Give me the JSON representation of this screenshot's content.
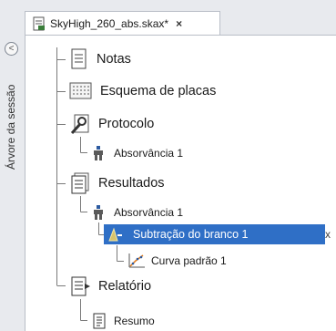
{
  "tab": {
    "title": "SkyHigh_260_abs.skax*",
    "close": "×"
  },
  "sidebar": {
    "label": "Árvore da sessão",
    "collapse": "<"
  },
  "tree": {
    "notas": "Notas",
    "esquema": "Esquema de placas",
    "protocolo": "Protocolo",
    "protocolo_abs": "Absorvância 1",
    "resultados": "Resultados",
    "resultados_abs": "Absorvância 1",
    "subtracao": "Subtração do branco 1",
    "subtracao_trailing": "x",
    "curva": "Curva padrão 1",
    "relatorio": "Relatório",
    "resumo": "Resumo"
  },
  "colors": {
    "selection": "#2f6fc6",
    "panel": "#ffffff",
    "chrome": "#e8eaee"
  }
}
